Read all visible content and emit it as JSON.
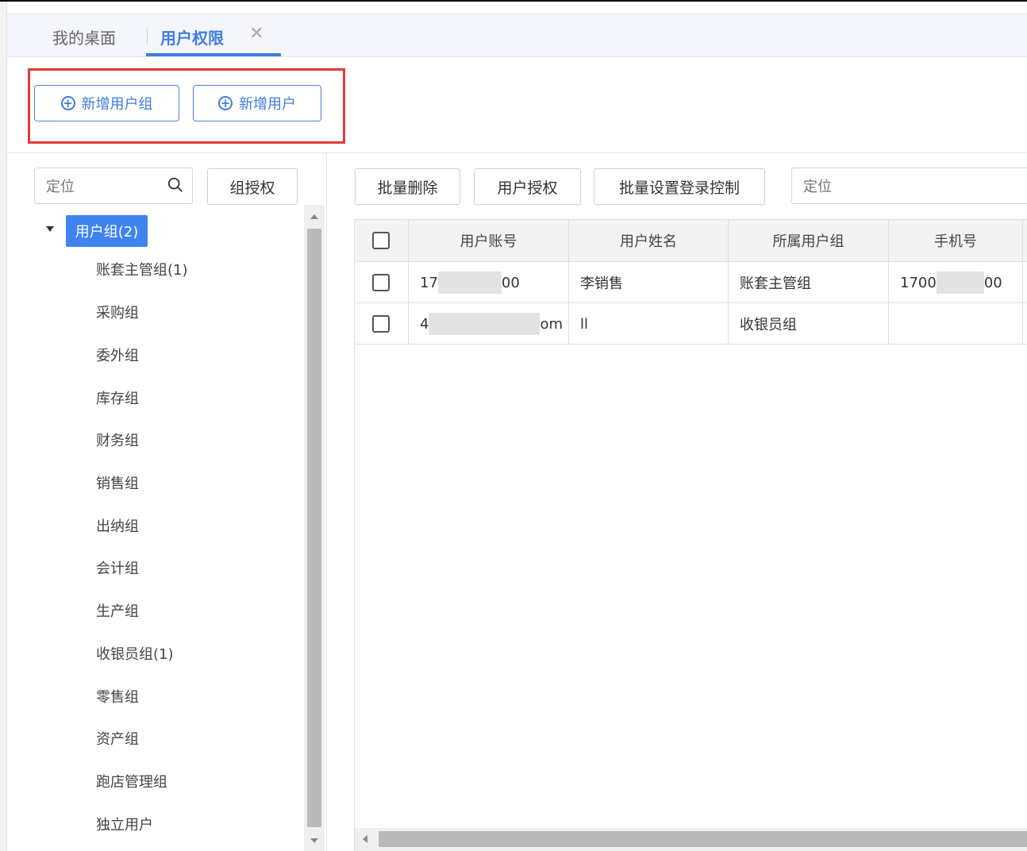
{
  "tabs": [
    {
      "label": "我的桌面",
      "active": false
    },
    {
      "label": "用户权限",
      "active": true
    }
  ],
  "toolbar": {
    "add_group_label": "新增用户组",
    "add_user_label": "新增用户"
  },
  "left": {
    "search_placeholder": "定位",
    "group_auth_label": "组授权",
    "tree_root": "用户组(2)",
    "tree_items": [
      "账套主管组(1)",
      "采购组",
      "委外组",
      "库存组",
      "财务组",
      "销售组",
      "出纳组",
      "会计组",
      "生产组",
      "收银员组(1)",
      "零售组",
      "资产组",
      "跑店管理组",
      "独立用户"
    ]
  },
  "right": {
    "batch_delete_label": "批量删除",
    "user_auth_label": "用户授权",
    "login_control_label": "批量设置登录控制",
    "locate_placeholder": "定位"
  },
  "table": {
    "headers": [
      "用户账号",
      "用户姓名",
      "所属用户组",
      "手机号"
    ],
    "rows": [
      {
        "account_start": "17",
        "account_end": "00",
        "name": "李销售",
        "group": "账套主管组",
        "phone_start": "1700",
        "phone_end": "00"
      },
      {
        "account_start": "4",
        "account_end": "om",
        "name": "ll",
        "group": "收银员组",
        "phone_start": "",
        "phone_end": ""
      }
    ]
  },
  "colors": {
    "accent": "#3f7de0",
    "highlight_border": "#e53935",
    "tree_selected_bg": "#3f83ee"
  },
  "icons": [
    "close-icon",
    "plus-circle-icon",
    "search-icon",
    "caret-down-icon"
  ]
}
